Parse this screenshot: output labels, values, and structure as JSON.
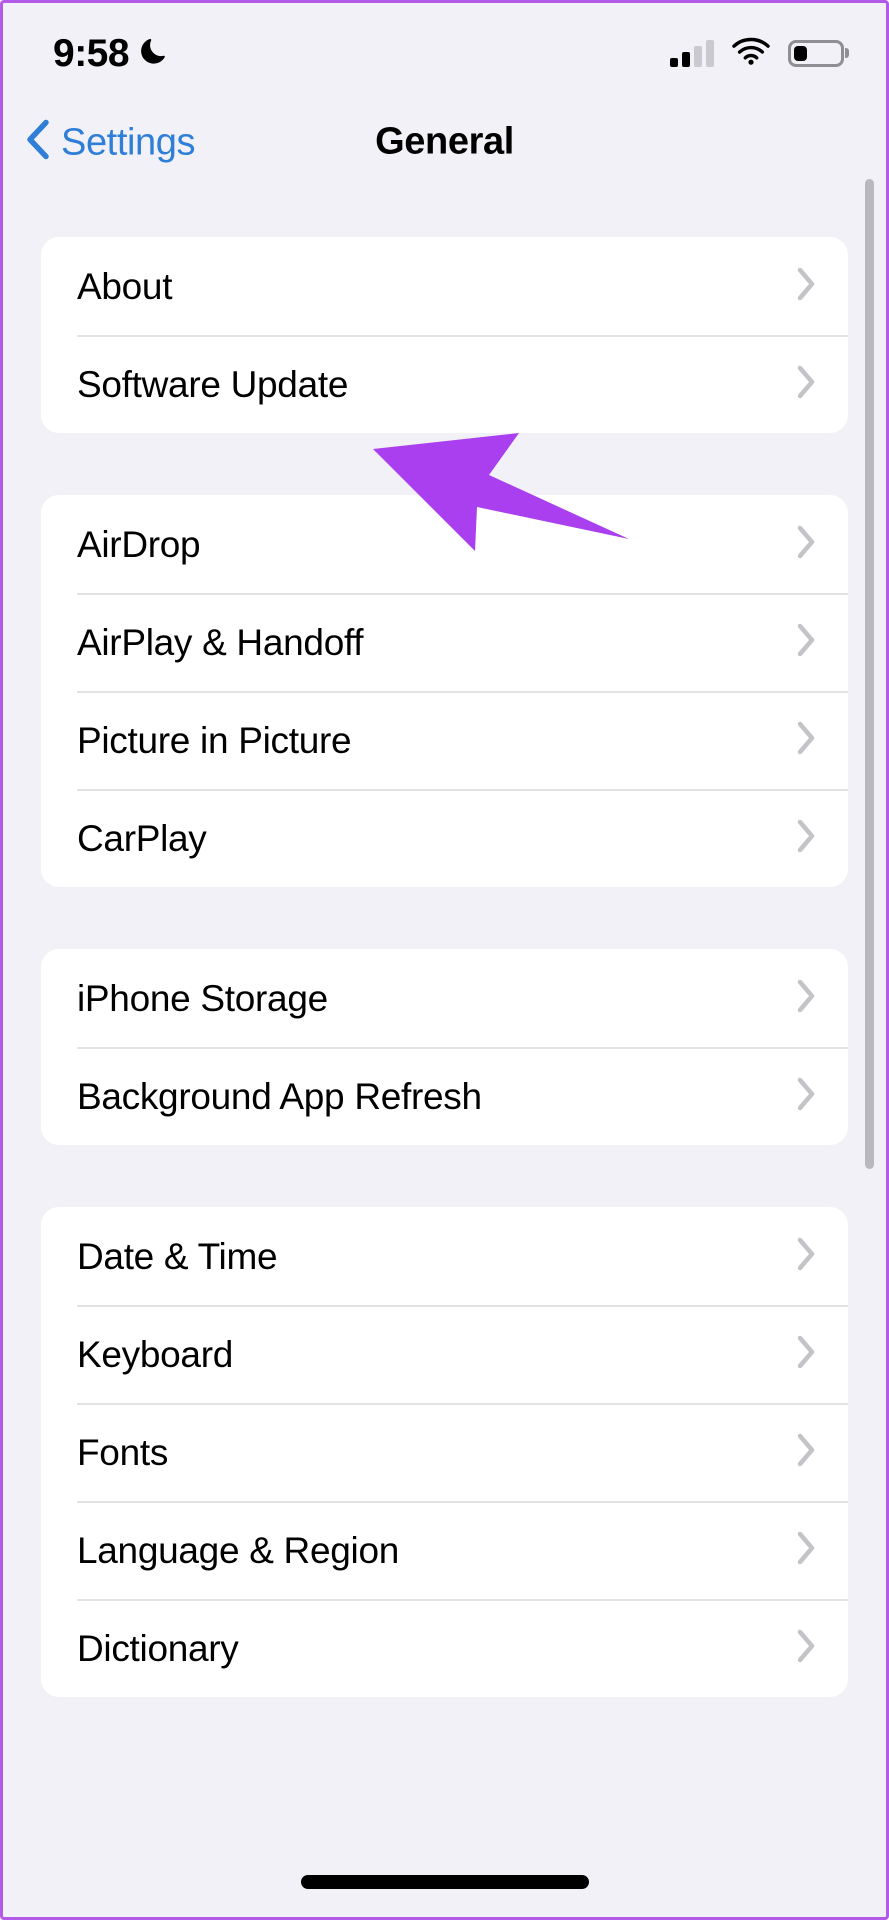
{
  "status_bar": {
    "time": "9:58",
    "focus_icon": "crescent-moon-icon",
    "signal_icon": "cellular-signal-icon",
    "signal_bars_filled": 2,
    "signal_bars_total": 4,
    "wifi_icon": "wifi-icon",
    "battery_icon": "battery-icon",
    "battery_percent": 30
  },
  "nav": {
    "back_label": "Settings",
    "back_icon": "chevron-left-icon",
    "title": "General"
  },
  "groups": [
    {
      "id": "group-system",
      "rows": [
        {
          "label": "About",
          "accessory": "chevron-right-icon"
        },
        {
          "label": "Software Update",
          "accessory": "chevron-right-icon"
        }
      ]
    },
    {
      "id": "group-connectivity",
      "rows": [
        {
          "label": "AirDrop",
          "accessory": "chevron-right-icon"
        },
        {
          "label": "AirPlay & Handoff",
          "accessory": "chevron-right-icon"
        },
        {
          "label": "Picture in Picture",
          "accessory": "chevron-right-icon"
        },
        {
          "label": "CarPlay",
          "accessory": "chevron-right-icon"
        }
      ]
    },
    {
      "id": "group-storage",
      "rows": [
        {
          "label": "iPhone Storage",
          "accessory": "chevron-right-icon"
        },
        {
          "label": "Background App Refresh",
          "accessory": "chevron-right-icon"
        }
      ]
    },
    {
      "id": "group-localization",
      "rows": [
        {
          "label": "Date & Time",
          "accessory": "chevron-right-icon"
        },
        {
          "label": "Keyboard",
          "accessory": "chevron-right-icon"
        },
        {
          "label": "Fonts",
          "accessory": "chevron-right-icon"
        },
        {
          "label": "Language & Region",
          "accessory": "chevron-right-icon"
        },
        {
          "label": "Dictionary",
          "accessory": "chevron-right-icon"
        }
      ]
    }
  ],
  "annotation": {
    "type": "arrow-pointer",
    "points_to": "Software Update",
    "color": "#a93fee"
  },
  "colors": {
    "page_background": "#f2f1f7",
    "card_background": "#ffffff",
    "separator": "#e3e3e6",
    "tint_blue": "#2f7fd8",
    "chevron_gray": "#c4c4c8",
    "label_primary": "#000000",
    "device_border": "#b45ae8",
    "scrollbar": "#b8b8bd",
    "home_indicator": "#000000"
  },
  "home_indicator_label": "home-indicator"
}
